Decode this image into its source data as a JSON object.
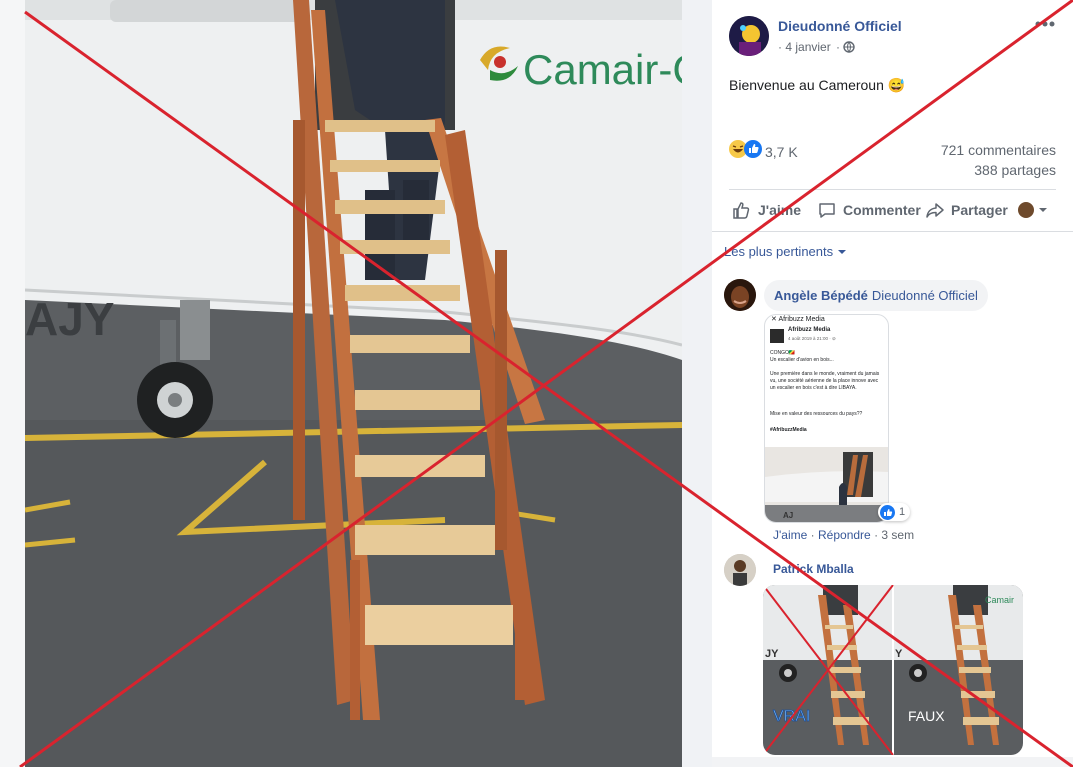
{
  "post": {
    "author": "Dieudonné Officiel",
    "date": "4 janvier",
    "separator": "·",
    "text": "Bienvenue au Cameroun 😅",
    "reactions_count": "3,7 K",
    "comments_count": "721 commentaires",
    "shares_count": "388 partages",
    "photo_sign": "Camair-Co",
    "photo_tail_letters": "AJY"
  },
  "actions": {
    "like": "J'aime",
    "comment": "Commenter",
    "share": "Partager"
  },
  "filter": {
    "label": "Les plus pertinents"
  },
  "comments": [
    {
      "author": "Angèle Bépédé",
      "tag": "Dieudonné Officiel",
      "reaction_count": "1",
      "like": "J'aime",
      "reply": "Répondre",
      "time": "3 sem",
      "dot": "·",
      "screenshot": {
        "source": "Afribuzz Media",
        "date": "4 août 2019 à 21:00 · ⊘",
        "lines": [
          "CONGO🇨🇬",
          "Un escalier d'avion en bois...",
          "Une première dans le monde, vraiment du jamais vu, une société aérienne de la place innove avec un escalier en bois c'est à dire LIBAYA.",
          "Mise en valeur des ressources du pays??",
          "#AfribuzzMedia"
        ]
      }
    },
    {
      "author": "Patrick Mballa",
      "image_labels": [
        "VRAI",
        "FAUX"
      ],
      "image_sign": "Camair"
    }
  ],
  "colors": {
    "link": "#385898",
    "cross": "#d9232e",
    "like_blue": "#1877f2"
  }
}
